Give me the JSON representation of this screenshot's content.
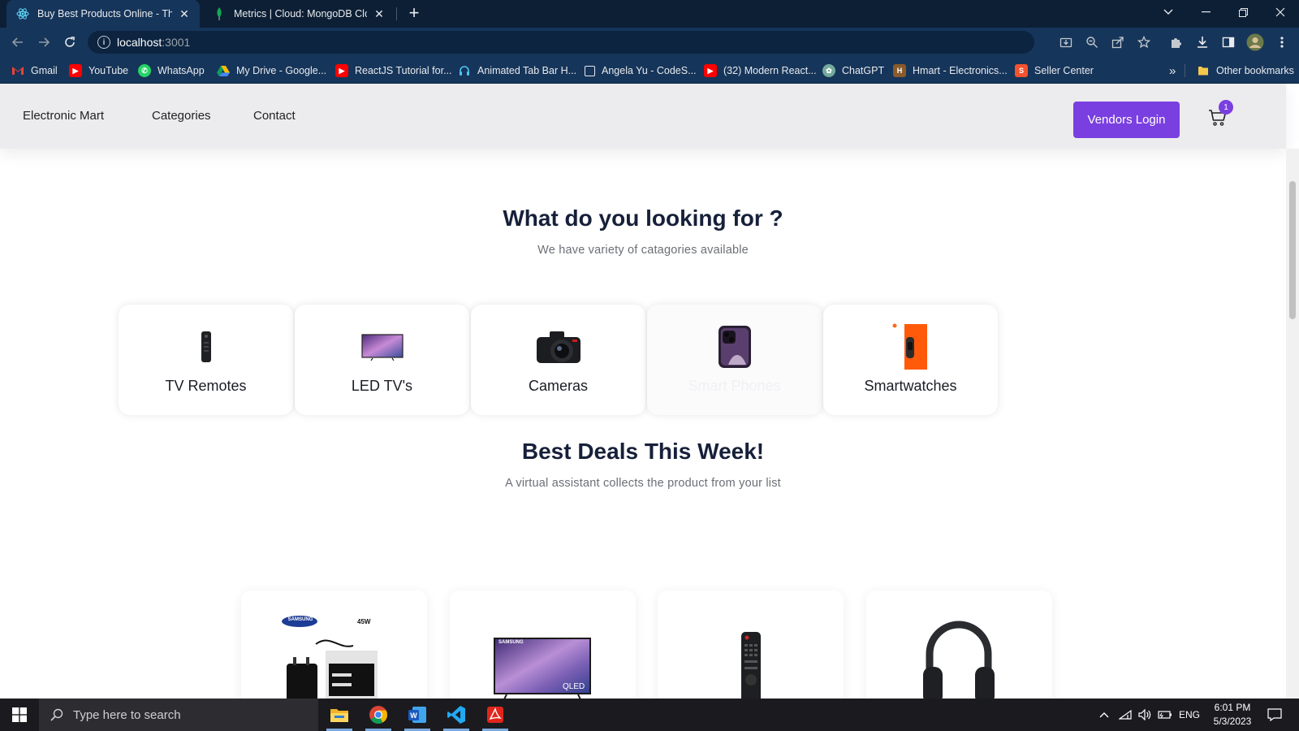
{
  "browser": {
    "tabs": [
      {
        "title": "Buy Best Products Online - TheEl",
        "icon": "react-icon",
        "active": true
      },
      {
        "title": "Metrics | Cloud: MongoDB Cloud",
        "icon": "mongodb-leaf-icon",
        "active": false
      }
    ],
    "new_tab_label": "+",
    "address": {
      "host": "localhost",
      "port": ":3001"
    },
    "bookmarks": [
      {
        "label": "Gmail",
        "icon": "gmail-icon"
      },
      {
        "label": "YouTube",
        "icon": "youtube-icon"
      },
      {
        "label": "WhatsApp",
        "icon": "whatsapp-icon"
      },
      {
        "label": "My Drive - Google...",
        "icon": "google-drive-icon"
      },
      {
        "label": "ReactJS Tutorial for...",
        "icon": "youtube-icon"
      },
      {
        "label": "Animated Tab Bar H...",
        "icon": "headphones-icon"
      },
      {
        "label": "Angela Yu - CodeS...",
        "icon": "page-icon"
      },
      {
        "label": "(32) Modern React...",
        "icon": "youtube-icon"
      },
      {
        "label": "ChatGPT",
        "icon": "chatgpt-icon"
      },
      {
        "label": "Hmart - Electronics...",
        "icon": "hmart-icon"
      },
      {
        "label": "Seller Center",
        "icon": "seller-center-icon"
      }
    ],
    "overflow_label": "»",
    "other_bookmarks": "Other bookmarks"
  },
  "site": {
    "nav": {
      "links": [
        "Electronic Mart",
        "Categories",
        "Contact"
      ],
      "vendors_login": "Vendors Login",
      "cart_count": "1"
    },
    "categories_section": {
      "title": "What do you looking for ?",
      "subtitle": "We have variety of catagories available",
      "items": [
        {
          "label": "TV Remotes",
          "icon": "tv-remote-image"
        },
        {
          "label": "LED TV's",
          "icon": "led-tv-image"
        },
        {
          "label": "Cameras",
          "icon": "camera-image"
        },
        {
          "label": "Smart Phones",
          "icon": "smartphone-image"
        },
        {
          "label": "Smartwatches",
          "icon": "smartwatch-image"
        }
      ]
    },
    "deals_section": {
      "title": "Best Deals This Week!",
      "subtitle": "A virtual assistant collects the product from your list",
      "products": [
        {
          "icon": "samsung-charger-image",
          "brand_text": "SAMSUNG",
          "watt_text": "45W"
        },
        {
          "icon": "samsung-qled-tv-image",
          "brand_text": "SAMSUNG",
          "badge_text": "QLED"
        },
        {
          "icon": "tv-remote-image"
        },
        {
          "icon": "headphones-image"
        }
      ]
    }
  },
  "taskbar": {
    "search_placeholder": "Type here to search",
    "apps": [
      "file-explorer-icon",
      "chrome-icon",
      "word-icon",
      "vscode-icon",
      "acrobat-icon"
    ],
    "language": "ENG",
    "time": "6:01 PM",
    "date": "5/3/2023"
  },
  "colors": {
    "accent": "#7a3fe0",
    "chrome_dark": "#0c1f35",
    "chrome_toolbar": "#16355a"
  }
}
